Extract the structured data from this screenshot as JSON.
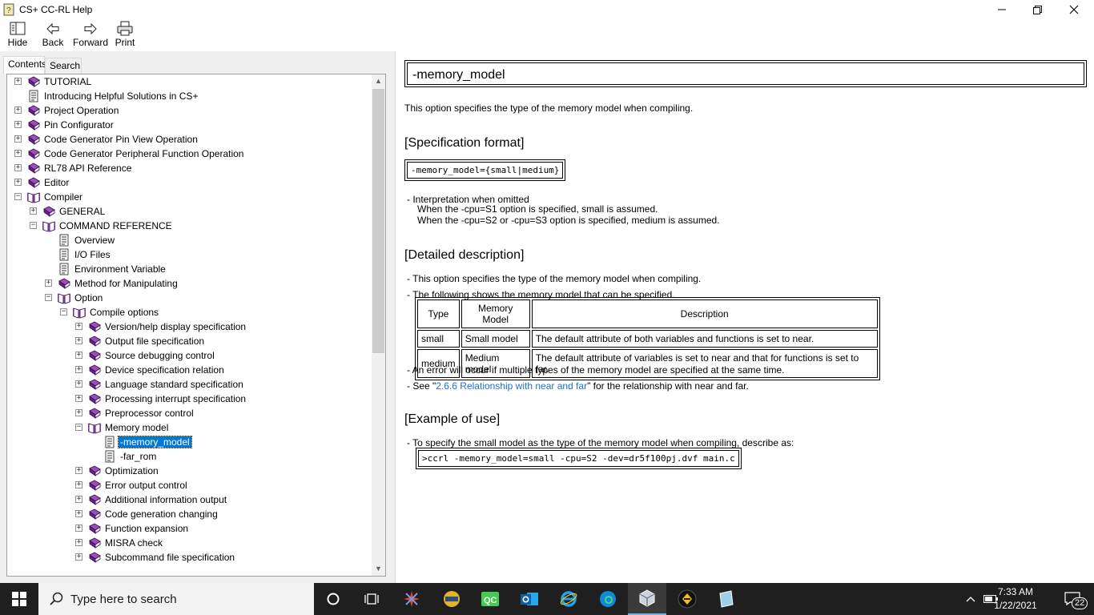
{
  "window": {
    "title": "CS+ CC-RL Help"
  },
  "toolbar": {
    "hide_label": "Hide",
    "back_label": "Back",
    "forward_label": "Forward",
    "print_label": "Print"
  },
  "tabs": {
    "contents": "Contents",
    "search": "Search"
  },
  "tree": {
    "items": [
      {
        "label": "TUTORIAL",
        "icon": "book-closed-icon",
        "expander": "+"
      },
      {
        "label": "Introducing Helpful Solutions in CS+",
        "icon": "page-icon",
        "expander": ""
      },
      {
        "label": "Project Operation",
        "icon": "book-closed-icon",
        "expander": "+"
      },
      {
        "label": "Pin Configurator",
        "icon": "book-closed-icon",
        "expander": "+"
      },
      {
        "label": "Code Generator Pin View Operation",
        "icon": "book-closed-icon",
        "expander": "+"
      },
      {
        "label": "Code Generator Peripheral Function Operation",
        "icon": "book-closed-icon",
        "expander": "+"
      },
      {
        "label": "RL78 API Reference",
        "icon": "book-closed-icon",
        "expander": "+"
      },
      {
        "label": "Editor",
        "icon": "book-closed-icon",
        "expander": "+"
      },
      {
        "label": "Compiler",
        "icon": "book-open-icon",
        "expander": "-"
      },
      {
        "label": "GENERAL",
        "icon": "book-closed-icon",
        "expander": "+"
      },
      {
        "label": "COMMAND REFERENCE",
        "icon": "book-open-icon",
        "expander": "-"
      },
      {
        "label": "Overview",
        "icon": "page-icon",
        "expander": ""
      },
      {
        "label": "I/O Files",
        "icon": "page-icon",
        "expander": ""
      },
      {
        "label": "Environment Variable",
        "icon": "page-icon",
        "expander": ""
      },
      {
        "label": "Method for Manipulating",
        "icon": "book-closed-icon",
        "expander": "+"
      },
      {
        "label": "Option",
        "icon": "book-open-icon",
        "expander": "-"
      },
      {
        "label": "Compile options",
        "icon": "book-open-icon",
        "expander": "-"
      },
      {
        "label": "Version/help display specification",
        "icon": "book-closed-icon",
        "expander": "+"
      },
      {
        "label": "Output file specification",
        "icon": "book-closed-icon",
        "expander": "+"
      },
      {
        "label": "Source debugging control",
        "icon": "book-closed-icon",
        "expander": "+"
      },
      {
        "label": "Device specification relation",
        "icon": "book-closed-icon",
        "expander": "+"
      },
      {
        "label": "Language standard specification",
        "icon": "book-closed-icon",
        "expander": "+"
      },
      {
        "label": "Processing interrupt specification",
        "icon": "book-closed-icon",
        "expander": "+"
      },
      {
        "label": "Preprocessor control",
        "icon": "book-closed-icon",
        "expander": "+"
      },
      {
        "label": "Memory model",
        "icon": "book-open-icon",
        "expander": "-"
      },
      {
        "label": "-memory_model",
        "icon": "page-icon",
        "expander": "",
        "selected": true
      },
      {
        "label": "-far_rom",
        "icon": "page-icon",
        "expander": ""
      },
      {
        "label": "Optimization",
        "icon": "book-closed-icon",
        "expander": "+"
      },
      {
        "label": "Error output control",
        "icon": "book-closed-icon",
        "expander": "+"
      },
      {
        "label": "Additional information output",
        "icon": "book-closed-icon",
        "expander": "+"
      },
      {
        "label": "Code generation changing",
        "icon": "book-closed-icon",
        "expander": "+"
      },
      {
        "label": "Function expansion",
        "icon": "book-closed-icon",
        "expander": "+"
      },
      {
        "label": "MISRA check",
        "icon": "book-closed-icon",
        "expander": "+"
      },
      {
        "label": "Subcommand file specification",
        "icon": "book-closed-icon",
        "expander": "+"
      }
    ]
  },
  "content": {
    "heading": "-memory_model",
    "intro": "This option specifies the type of the memory model when compiling.",
    "spec_title": "[Specification format]",
    "spec_code": "-memory_model={small|medium}",
    "omitted_1": "-  Interpretation when omitted",
    "omitted_2": "When the -cpu=S1 option is specified, small is assumed.",
    "omitted_3": "When the -cpu=S2 or -cpu=S3 option is specified, medium is assumed.",
    "detail_title": "[Detailed description]",
    "detail_1": "-  This option specifies the type of the memory model when compiling.",
    "detail_2": "-  The following shows the memory model that can be specified.",
    "table": {
      "headers": [
        "Type",
        "Memory Model",
        "Description"
      ],
      "rows": [
        [
          "small",
          "Small model",
          "The default attribute of both variables and functions is set to near."
        ],
        [
          "medium",
          "Medium model",
          "The default attribute of variables is set to near and that for functions is set to far."
        ]
      ]
    },
    "detail_3": "-  An error will occur if multiple types of the memory model are specified at the same time.",
    "see_prefix": "-  See \"",
    "see_link": "2.6.6 Relationship with near and far",
    "see_suffix": "\" for the relationship with near and far.",
    "example_title": "[Example of use]",
    "example_text": "-  To specify the small model as the type of the memory model when compiling, describe as:",
    "example_code": ">ccrl -memory_model=small -cpu=S2 -dev=dr5f100pj.dvf main.c"
  },
  "taskbar": {
    "search_placeholder": "Type here to search",
    "time": "7:33 AM",
    "date": "1/22/2021",
    "notification_count": "22"
  }
}
